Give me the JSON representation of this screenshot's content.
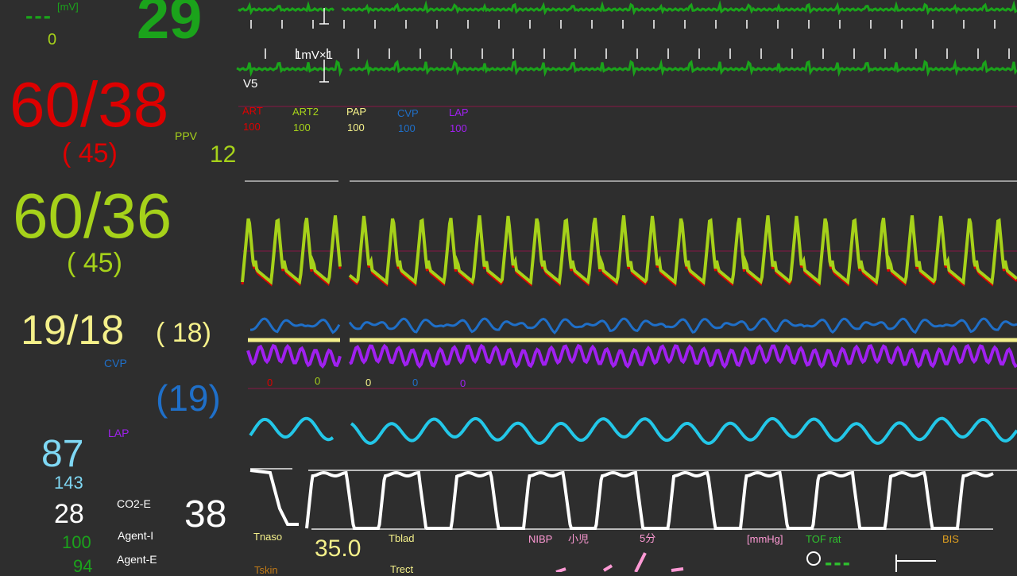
{
  "colors": {
    "background": "#2e2e2e",
    "ecg": "#1ba31b",
    "art": "#dd0000",
    "art2": "#a6d21a",
    "pap": "#f4f08a",
    "cvp": "#1f6fc8",
    "lap": "#a020f0",
    "spo2": "#23c7e8",
    "co2": "#ffffff",
    "nibp": "#ff9ad5",
    "tof": "#2ec12e",
    "bis": "#e0a020",
    "tskin": "#c07a18"
  },
  "ecg_panel": {
    "dashes": "---",
    "unit": "[mV]",
    "value": "0",
    "heart_rate": "29",
    "calibration_label": "1mV×1",
    "lead_label": "V5"
  },
  "pressure_scale_labels": [
    {
      "name": "ART",
      "scale": "100"
    },
    {
      "name": "ART2",
      "scale": "100"
    },
    {
      "name": "PAP",
      "scale": "100"
    },
    {
      "name": "CVP",
      "scale": "100"
    },
    {
      "name": "LAP",
      "scale": "100"
    }
  ],
  "pressure_zero_labels": [
    "0",
    "0",
    "0",
    "0",
    "0"
  ],
  "art": {
    "value": "60/38",
    "mean": "( 45)"
  },
  "ppv": {
    "label": "PPV",
    "value": "12"
  },
  "art2": {
    "value": "60/36",
    "mean": "( 45)"
  },
  "pap": {
    "value": "19/18",
    "mean": "( 18)"
  },
  "cvp": {
    "label": "CVP",
    "value": "(19)"
  },
  "lap": {
    "label": "LAP"
  },
  "spo2": {
    "value": "87",
    "pulse": "143"
  },
  "co2": {
    "value": "28",
    "label": "CO2-E",
    "resp_rate": "38",
    "agent_i_label": "Agent-I",
    "agent_i_value": "100",
    "agent_e_label": "Agent-E",
    "agent_e_value": "94"
  },
  "temperatures": {
    "tnaso_label": "Tnaso",
    "tnaso_value": "35.0",
    "tblad_label": "Tblad",
    "tskin_label": "Tskin",
    "trect_label": "Trect"
  },
  "nibp": {
    "label": "NIBP",
    "mode": "小児",
    "interval": "5分",
    "unit": "[mmHg]"
  },
  "tof": {
    "label": "TOF rat",
    "value": "---"
  },
  "bis": {
    "label": "BIS"
  }
}
